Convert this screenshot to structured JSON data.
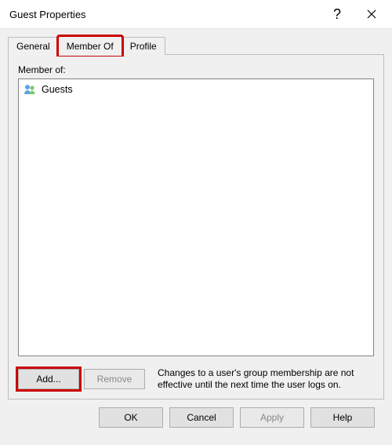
{
  "window": {
    "title": "Guest Properties"
  },
  "tabs": {
    "general": "General",
    "member_of": "Member Of",
    "profile": "Profile",
    "active": "member_of"
  },
  "panel": {
    "label": "Member of:",
    "items": [
      {
        "name": "Guests"
      }
    ],
    "add_label": "Add...",
    "remove_label": "Remove",
    "hint": "Changes to a user's group membership are not effective until the next time the user logs on."
  },
  "footer": {
    "ok": "OK",
    "cancel": "Cancel",
    "apply": "Apply",
    "help": "Help"
  }
}
